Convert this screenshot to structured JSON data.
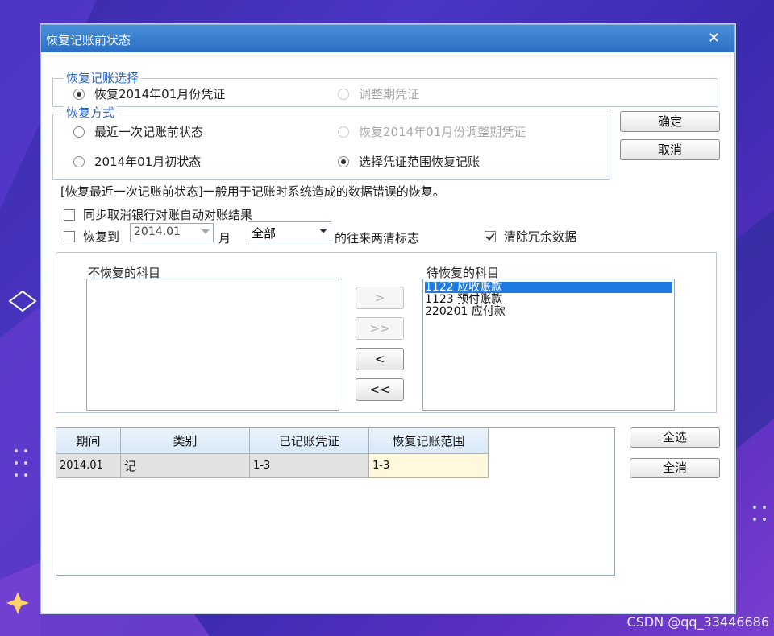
{
  "dialog": {
    "title": "恢复记账前状态",
    "close_glyph": "✕"
  },
  "group_select": {
    "legend": "恢复记账选择",
    "option_restore_month": "恢复2014年01月份凭证",
    "option_adjust_period": "调整期凭证"
  },
  "group_mode": {
    "legend": "恢复方式",
    "option_last_before": "最近一次记账前状态",
    "option_restore_adjust": "恢复2014年01月份调整期凭证",
    "option_month_begin": "2014年01月初状态",
    "option_select_range": "选择凭证范围恢复记账"
  },
  "buttons": {
    "ok": "确定",
    "cancel": "取消",
    "move_right": ">",
    "move_all_right": ">>",
    "move_left": "<",
    "move_all_left": "<<",
    "select_all": "全选",
    "clear_all": "全消"
  },
  "hint": "[恢复最近一次记账前状态]一般用于记账时系统造成的数据错误的恢复。",
  "options": {
    "sync_cancel_bank": "同步取消银行对账自动对账结果",
    "restore_to": "恢复到",
    "restore_to_period": "2014.01",
    "month_label": "月",
    "scope_value": "全部",
    "clear_flag_label": "的往来两清标志",
    "remove_redundant": "清除冗余数据"
  },
  "accounts": {
    "left_label": "不恢复的科目",
    "right_label": "待恢复的科目",
    "left_items": [],
    "right_items": [
      "1122 应收账款",
      "1123 预付账款",
      "220201 应付款"
    ]
  },
  "table": {
    "headers": [
      "期间",
      "类别",
      "已记账凭证",
      "恢复记账范围"
    ],
    "rows": [
      [
        "2014.01",
        "记",
        "1-3",
        "1-3"
      ]
    ]
  },
  "watermark": "CSDN @qq_33446686"
}
